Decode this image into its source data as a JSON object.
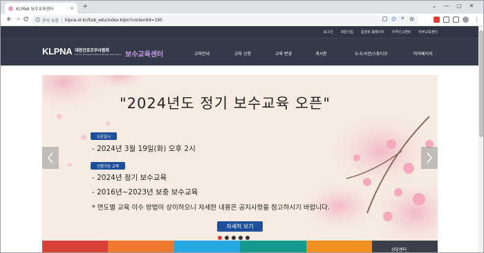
{
  "browser": {
    "tab_title": "KLPNA 보수교육센터",
    "tab_close": "×",
    "new_tab": "+",
    "security_label": "주의 요함",
    "url": "klpna.or.kr/Sub_edu/index.klpn?contentId=195",
    "window_controls": [
      "⌄",
      "—",
      "▢",
      "✕"
    ],
    "nav_icons": [
      "back-icon",
      "forward-icon",
      "reload-icon"
    ]
  },
  "site": {
    "utility_links": [
      "로그인",
      "회원가입",
      "중앙회 홈페이지",
      "자격신고센터",
      "직무교육센터"
    ],
    "logo_mark": "KLPNA",
    "logo_kr": "대한간호조무사협회",
    "logo_en": "Korean Licensed Practical Nurses Association",
    "site_title": "보수교육센터",
    "menu": [
      "교육안내",
      "교육 신청",
      "교육 변경",
      "게시판",
      "E-도서관/스튜디오",
      "마이페이지"
    ]
  },
  "hero": {
    "title": "\"2024년도 정기 보수교육 오픈\"",
    "open_label": "오픈일시",
    "open_date": "- 2024년 3월 19일(화) 오후 2시",
    "available_label": "신청가능 교육",
    "course1": "- 2024년 정기 보수교육",
    "course2": "- 2016년~2023년 보충 보수교육",
    "note": "* 연도별 교육 이수 방법이 상이하오니 자세한 내용은 공지사항을 참고하시기 바랍니다.",
    "detail_button": "자세히 보기",
    "slide_count": 5,
    "active_slide": 1
  },
  "bottom_bar": {
    "colors": [
      "#d8413a",
      "#ef7a2f",
      "#26a9e0",
      "#169a8d",
      "#f2901f"
    ],
    "dark_label": "상담센터"
  }
}
